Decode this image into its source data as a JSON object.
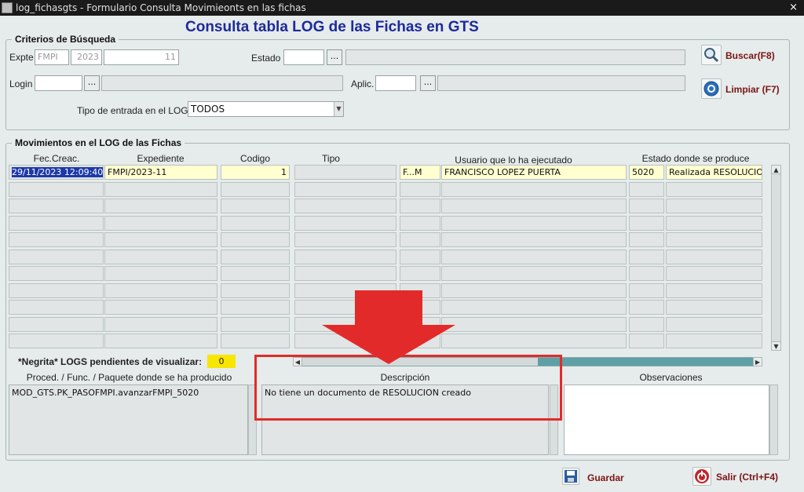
{
  "window": {
    "title": "log_fichasgts - Formulario Consulta Movimieonts en las fichas",
    "close": "×"
  },
  "header": {
    "title": "Consulta tabla LOG de las Fichas en GTS"
  },
  "search": {
    "legend": "Criterios de Búsqueda",
    "expte_label": "Expte",
    "expte_type": "FMPI",
    "expte_year": "2023",
    "expte_number": "11",
    "estado_label": "Estado",
    "login_label": "Login",
    "aplic_label": "Aplic.",
    "tipo_label": "Tipo de entrada en el LOG",
    "tipo_value": "TODOS",
    "dots": "..."
  },
  "buttons": {
    "buscar": "Buscar(F8)",
    "limpiar": "Limpiar (F7)",
    "guardar": "Guardar",
    "salir": "Salir (Ctrl+F4)"
  },
  "grid": {
    "legend": "Movimientos en el LOG de las Fichas",
    "headers": [
      "Fec.Creac.",
      "Expediente",
      "Codigo",
      "Tipo",
      "Usuario que lo ha ejecutado",
      "Estado donde se produce"
    ],
    "row1": {
      "fecha": "29/11/2023 12:09:40",
      "expediente": "FMPI/2023-11",
      "codigo": "1",
      "tipo": "",
      "user_code": "F...M",
      "user_name": "FRANCISCO LOPEZ PUERTA",
      "estado_code": "5020",
      "estado_desc": "Realizada RESOLUCION"
    }
  },
  "pending": {
    "label": "*Negrita* LOGS pendientes de visualizar:",
    "count": "0"
  },
  "details": {
    "proc_header": "Proced. / Func. / Paquete donde se ha producido",
    "proc_value": "MOD_GTS.PK_PASOFMPI.avanzarFMPI_5020",
    "desc_header": "Descripción",
    "desc_value": "No tiene un documento de RESOLUCION creado",
    "obs_header": "Observaciones",
    "obs_value": ""
  },
  "colors": {
    "title_blue": "#1d2a9b",
    "button_text": "#7a1414",
    "annotation_red": "#e32a2a",
    "selection": "#1d39a8",
    "pending_badge": "#f7e600"
  }
}
